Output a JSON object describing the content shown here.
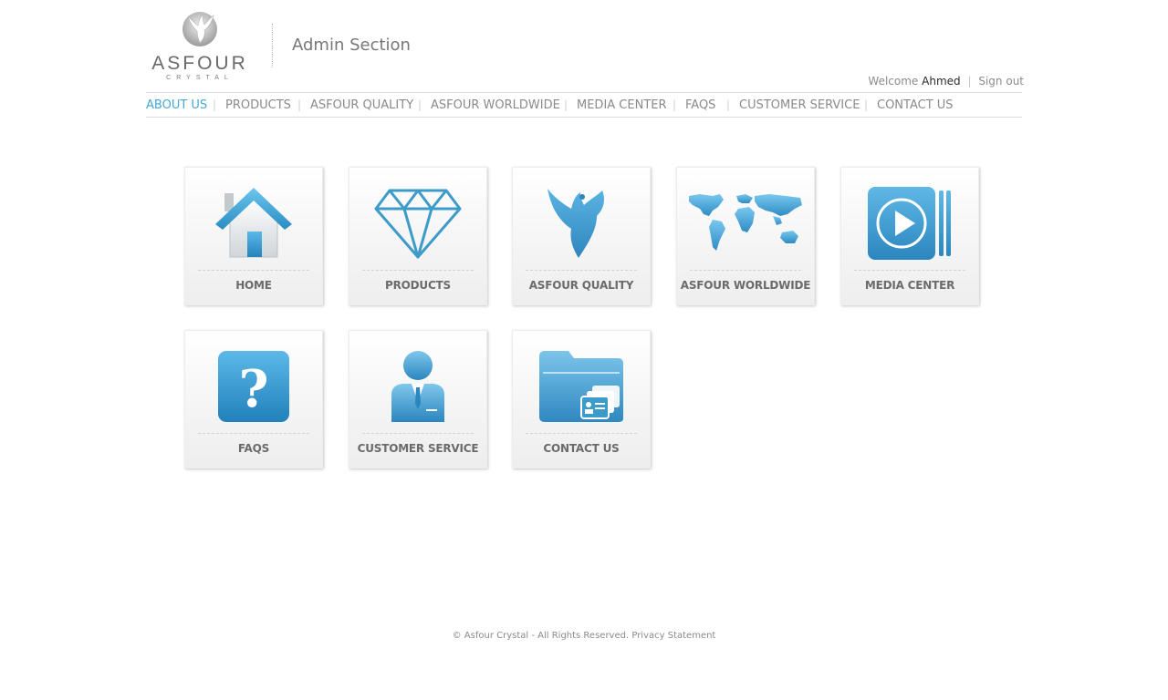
{
  "brand": {
    "name": "ASFOUR",
    "tagline": "CRYSTAL"
  },
  "header": {
    "title": "Admin Section",
    "welcome": "Welcome",
    "user": "Ahmed",
    "signout": "Sign out"
  },
  "nav": {
    "items": [
      {
        "label": "ABOUT US",
        "active": true
      },
      {
        "label": "PRODUCTS"
      },
      {
        "label": "ASFOUR QUALITY"
      },
      {
        "label": "ASFOUR WORLDWIDE"
      },
      {
        "label": "MEDIA CENTER"
      },
      {
        "label": "FAQS"
      },
      {
        "label": "CUSTOMER SERVICE"
      },
      {
        "label": "CONTACT US"
      }
    ]
  },
  "tiles": [
    {
      "label": "HOME",
      "icon": "home-icon"
    },
    {
      "label": "PRODUCTS",
      "icon": "diamond-icon"
    },
    {
      "label": "ASFOUR QUALITY",
      "icon": "bird-icon"
    },
    {
      "label": "ASFOUR WORLDWIDE",
      "icon": "world-map-icon"
    },
    {
      "label": "MEDIA CENTER",
      "icon": "play-icon"
    },
    {
      "label": "FAQS",
      "icon": "question-icon"
    },
    {
      "label": "CUSTOMER SERVICE",
      "icon": "person-icon"
    },
    {
      "label": "CONTACT US",
      "icon": "folder-contact-icon"
    }
  ],
  "footer": {
    "copyright": "© Asfour Crystal - All Rights Reserved.",
    "privacy": "Privacy Statement"
  },
  "colors": {
    "accent": "#43a9d3",
    "icon_blue": "#3d9bc9",
    "text": "#6b6b6b"
  }
}
